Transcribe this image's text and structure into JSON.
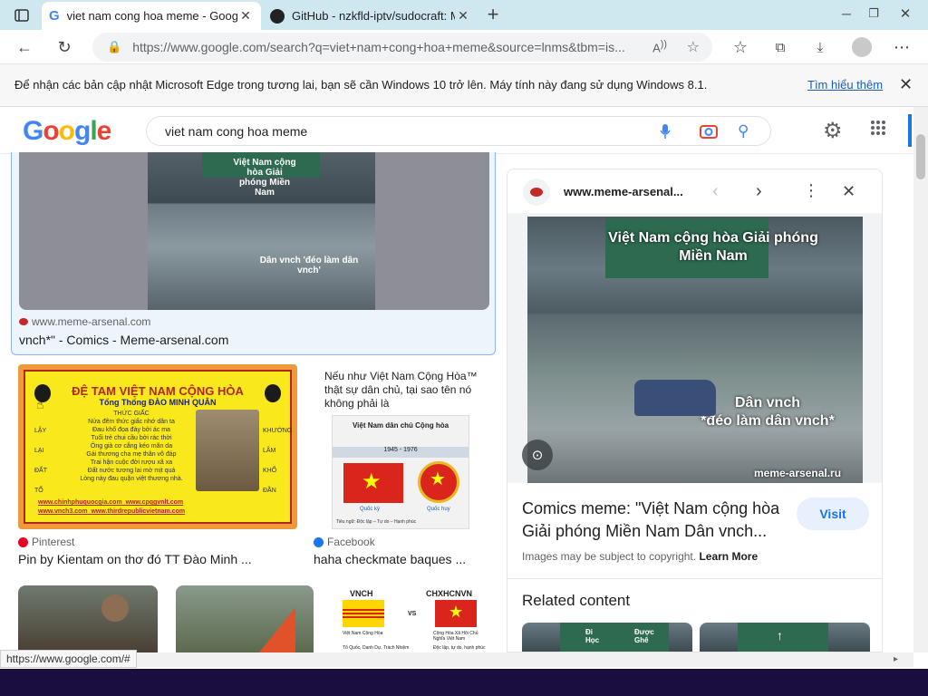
{
  "browser": {
    "tabs": [
      {
        "title": "viet nam cong hoa meme - Goog",
        "active": true
      },
      {
        "title": "GitHub - nzkfld-iptv/sudocraft: M",
        "active": false
      }
    ],
    "address": "https://www.google.com/search?q=viet+nam+cong+hoa+meme&source=lnms&tbm=is...",
    "status_url": "https://www.google.com/#"
  },
  "notification": {
    "message": "Để nhận các bản cập nhật Microsoft Edge trong tương lai, bạn sẽ cần Windows 10 trở lên. Máy tính này đang sử dụng Windows 8.1.",
    "link": "Tìm hiểu thêm"
  },
  "google": {
    "logo": "Google",
    "query": "viet nam cong hoa meme"
  },
  "results": {
    "top": {
      "source": "www.meme-arsenal.com",
      "title": "vnch*\" - Comics - Meme-arsenal.com",
      "img_top": "Việt Nam cộng hòa Giải phóng Miền Nam",
      "img_bottom": "Dân vnch 'đéo làm dân vnch'"
    },
    "card1": {
      "source": "Pinterest",
      "title": "Pin by Kientam on thơ đó TT Đào Minh ...",
      "img_heading": "ĐỆ TAM VIỆT NAM CỘNG HÒA",
      "img_sub": "Tổng Thống ĐÀO MINH QUÂN",
      "img_poem_title": "THỨC GIẤC",
      "img_poem": [
        "Nửa đêm thức giấc nhớ dân ta",
        "Đau khổ đọa đày bởi ác ma",
        "Tuổi trẻ chui cầu bởi rác thời",
        "Ông già cơ cắng kéo mãn da",
        "Gái thương cha mẹ thân vô đáp",
        "Trai hận cuộc đời rượu xã xa",
        "Đất nước tương lai mờ mịt quá",
        "Lòng này đau quặn việt thương nhà."
      ],
      "img_side_left": [
        "LẬY",
        "LẠI",
        "ĐẤT",
        "TỔ"
      ],
      "img_side_right": [
        "KHƯỚNG",
        "LÂM",
        "KHỔ",
        "ĐẦN"
      ],
      "img_links": [
        "www.chinhphuquocgia.com",
        "www.cpqgvnlt.com",
        "www.vnch3.com",
        "www.thirdrepublicvietnam.com"
      ]
    },
    "card2": {
      "source": "Facebook",
      "title": "haha checkmate baques ...",
      "img_caption": "Nếu như Việt Nam Cộng Hòa™ thật sự dân chủ, tại sao tên nó không phải là",
      "img_box_title": "Việt Nam dân chủ Cộng hòa",
      "img_years": "1945 - 1976",
      "img_flag_label": "Quốc kỳ",
      "img_emblem_label": "Quốc huy",
      "img_motto": "Tiêu ngữ: Độc lập – Tự do – Hạnh phúc"
    },
    "row3": {
      "vnch": "VNCH",
      "vs": "VS",
      "chxhcnvn": "CHXHCNVN",
      "vnch_sub": "Việt Nam Cộng Hòa",
      "chxh_sub": "Cộng Hòa Xã Hội Chủ Nghĩa Việt Nam",
      "vnch_motto": "Tổ Quốc, Danh Dự, Trách Nhiệm",
      "chxh_motto": "Độc lập, tự do, hạnh phúc"
    }
  },
  "panel": {
    "site": "www.meme-arsenal...",
    "img_top": "Việt Nam cộng hòa Giải phóng Miền Nam",
    "img_bottom_1": "Dân vnch",
    "img_bottom_2": "*đéo làm dân vnch*",
    "watermark": "meme-arsenal.ru",
    "title": "Comics meme: \"Việt Nam cộng hòa Giải phóng Miền Nam Dân vnch...",
    "visit": "Visit",
    "copyright": "Images may be subject to copyright.",
    "learn_more": "Learn More",
    "related_heading": "Related content",
    "related_sign_1": "Đi",
    "related_sign_2": "Học",
    "related_sign_3": "Được",
    "related_sign_4": "Ghê"
  },
  "colors": {
    "accent": "#1a73e8",
    "tab_strip": "#cfe8f0",
    "taskbar": "#1a0e3f"
  }
}
